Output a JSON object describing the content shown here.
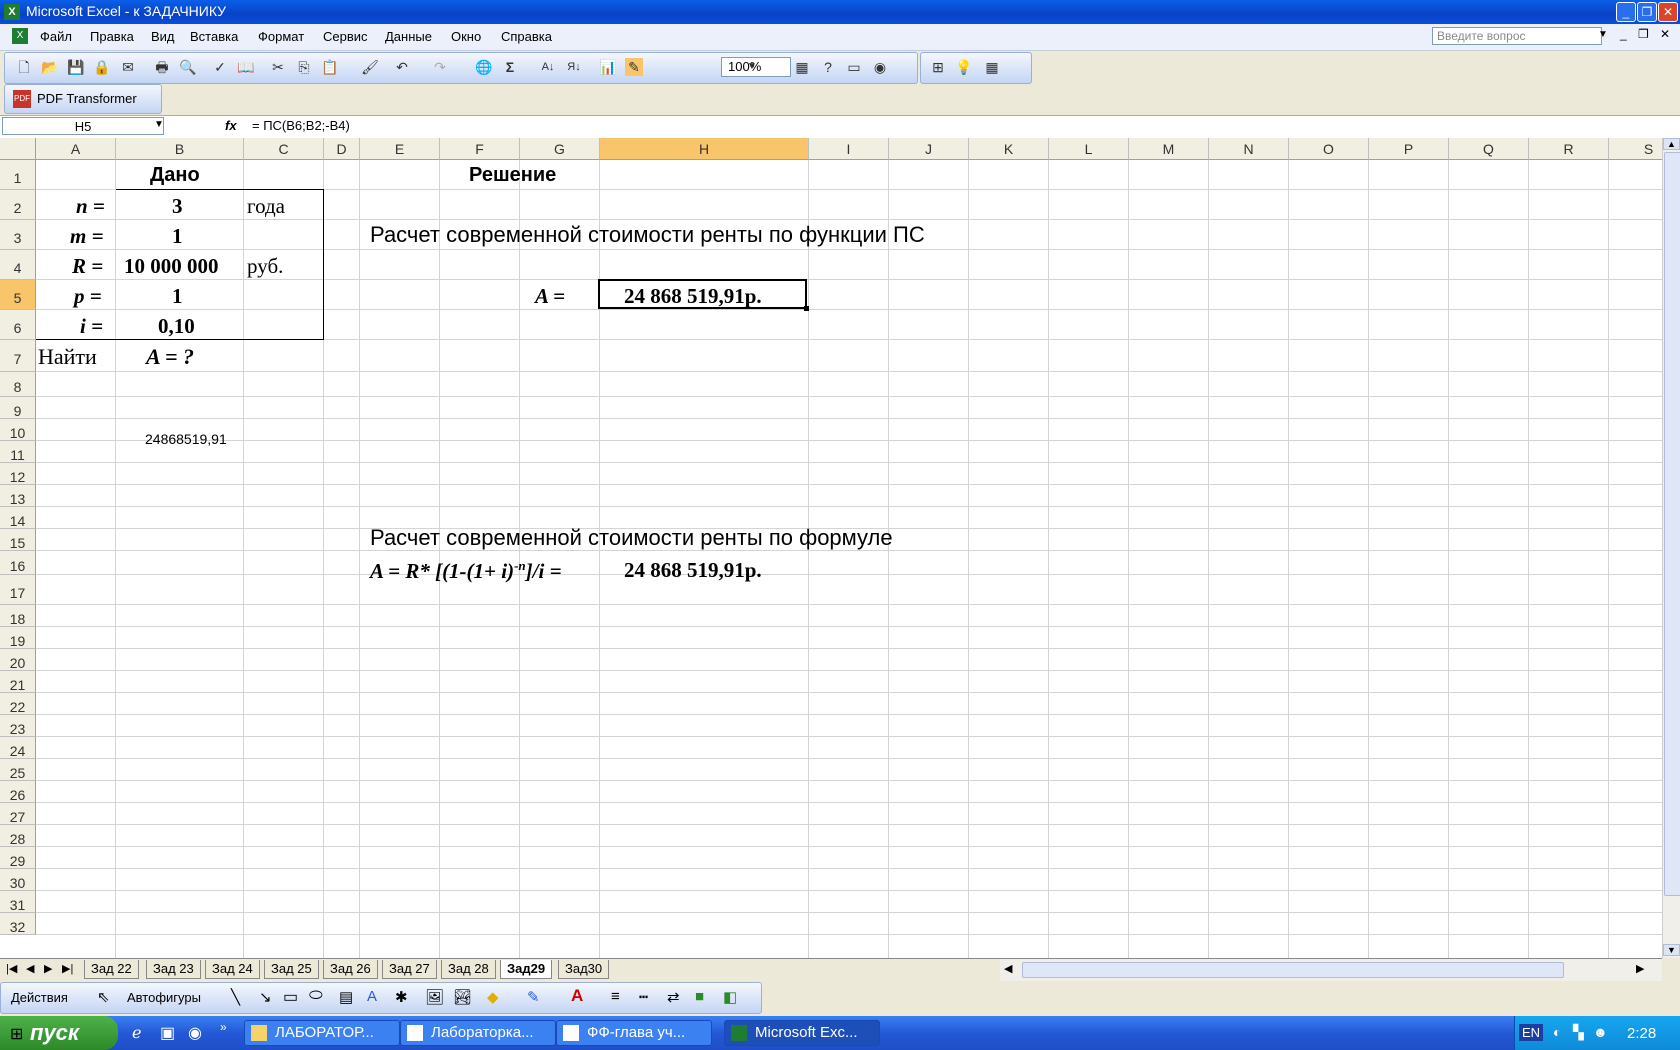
{
  "window": {
    "title": "Microsoft Excel - к ЗАДАЧНИКУ"
  },
  "menu": [
    "Файл",
    "Правка",
    "Вид",
    "Вставка",
    "Формат",
    "Сервис",
    "Данные",
    "Окно",
    "Справка"
  ],
  "ask_placeholder": "Введите вопрос",
  "toolbar": {
    "zoom": "100%",
    "pdf_label": "PDF Transformer"
  },
  "formula_bar": {
    "name_box": "H5",
    "fx": "fx",
    "formula": "= ПС(B6;B2;-B4)"
  },
  "columns": [
    "A",
    "B",
    "C",
    "D",
    "E",
    "F",
    "G",
    "H",
    "I",
    "J",
    "K",
    "L",
    "M",
    "N",
    "O",
    "P",
    "Q",
    "R",
    "S"
  ],
  "rows": [
    "1",
    "2",
    "3",
    "4",
    "5",
    "6",
    "7",
    "8",
    "9",
    "10",
    "11",
    "12",
    "13",
    "14",
    "15",
    "16",
    "17",
    "18",
    "19",
    "20",
    "21",
    "22",
    "23",
    "24",
    "25",
    "26",
    "27",
    "28",
    "29",
    "30",
    "31",
    "32"
  ],
  "cells": {
    "B1": "Дано",
    "A2": "n =",
    "B2": "3",
    "C2": "года",
    "A3": "m =",
    "B3": "1",
    "A4": "R =",
    "B4": "10 000 000",
    "C4": "руб.",
    "A5": "p =",
    "B5": "1",
    "A6": "i =",
    "B6": "0,10",
    "A7": "Найти",
    "B7": "A = ?",
    "B10": "24868519,91",
    "G1": "Решение",
    "E3": "Расчет современной стоимости ренты по функции ПС",
    "G5": "A  =",
    "H5": "24 868 519,91р.",
    "E16": "Расчет современной стоимости ренты по формуле",
    "E17": "A = R* [(1-(1+ i)",
    "E17_sup": "-n",
    "E17_end": "]/i =",
    "H17": "24 868 519,91р."
  },
  "sheet_tabs": [
    "Зад 22",
    "Зад 23",
    "Зад 24",
    "Зад 25",
    "Зад 26",
    "Зад 27",
    "Зад 28",
    "Зад29",
    "Зад30"
  ],
  "active_sheet": "Зад29",
  "drawing_toolbar": {
    "actions": "Действия",
    "autoshapes": "Автофигуры"
  },
  "taskbar": {
    "start": "пуск",
    "items": [
      "ЛАБОРАТОР...",
      "Лабораторка...",
      "ФФ-глава уч...",
      "Microsoft Exc..."
    ],
    "lang": "EN",
    "clock": "2:28"
  }
}
